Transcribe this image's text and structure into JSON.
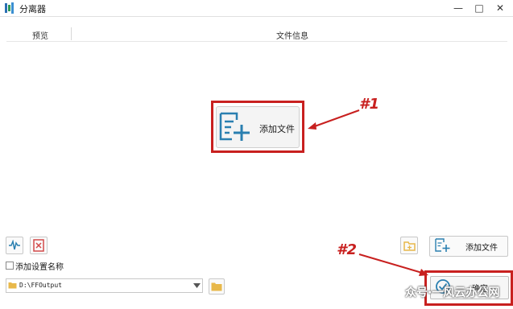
{
  "window": {
    "title": "分离器",
    "minimize_glyph": "—",
    "maximize_glyph": "□",
    "close_glyph": "✕"
  },
  "table": {
    "col_preview": "预览",
    "col_fileinfo": "文件信息"
  },
  "center": {
    "add_file_label": "添加文件",
    "icon": "add-document-icon"
  },
  "annotations": {
    "a1": "#1",
    "a2": "#2"
  },
  "toolbar": {
    "add_file_label": "添加文件"
  },
  "options": {
    "add_settings_name_label": "添加设置名称",
    "checked": false
  },
  "output": {
    "path": "D:\\FFOutput"
  },
  "confirm": {
    "label": "确定",
    "icon": "check-circle-icon"
  },
  "watermark": {
    "text": "众号·一风云办公网"
  },
  "colors": {
    "annotation_red": "#c8201f",
    "icon_blue": "#2a7fb0",
    "folder_yellow": "#e8b84a"
  }
}
